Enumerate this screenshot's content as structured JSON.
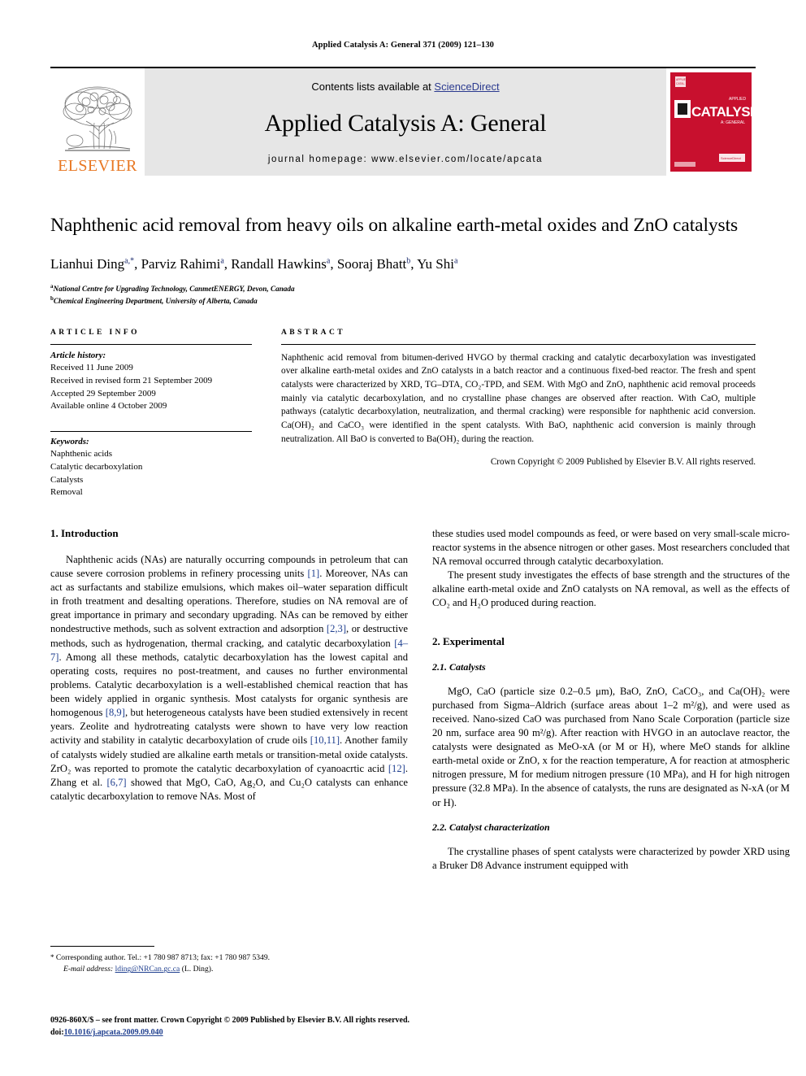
{
  "running_head": "Applied Catalysis A: General 371 (2009) 121–130",
  "masthead": {
    "publisher_name": "ELSEVIER",
    "contents_prefix": "Contents lists available at ",
    "contents_link": "ScienceDirect",
    "journal_title": "Applied Catalysis A: General",
    "homepage_line": "journal homepage: www.elsevier.com/locate/apcata",
    "cover_title": "CATALYSIS",
    "cover_supertitle": "APPLIED",
    "cover_subtitle": "A: GENERAL",
    "cover_color": "#C8102E",
    "link_color": "#2b3a8f",
    "elsevier_orange": "#E87722"
  },
  "title": "Naphthenic acid removal from heavy oils on alkaline earth-metal oxides and ZnO catalysts",
  "authors": {
    "list": [
      {
        "name": "Lianhui Ding",
        "marks": "a,*"
      },
      {
        "name": "Parviz Rahimi",
        "marks": "a"
      },
      {
        "name": "Randall Hawkins",
        "marks": "a"
      },
      {
        "name": "Sooraj Bhatt",
        "marks": "b"
      },
      {
        "name": "Yu Shi",
        "marks": "a"
      }
    ]
  },
  "affiliations": [
    {
      "mark": "a",
      "text": "National Centre for Upgrading Technology, CanmetENERGY, Devon, Canada"
    },
    {
      "mark": "b",
      "text": "Chemical Engineering Department, University of Alberta, Canada"
    }
  ],
  "article_info": {
    "heading": "ARTICLE INFO",
    "history_label": "Article history:",
    "history": [
      "Received 11 June 2009",
      "Received in revised form 21 September 2009",
      "Accepted 29 September 2009",
      "Available online 4 October 2009"
    ],
    "keywords_label": "Keywords:",
    "keywords": [
      "Naphthenic acids",
      "Catalytic decarboxylation",
      "Catalysts",
      "Removal"
    ]
  },
  "abstract": {
    "heading": "ABSTRACT",
    "text": "Naphthenic acid removal from bitumen-derived HVGO by thermal cracking and catalytic decarboxylation was investigated over alkaline earth-metal oxides and ZnO catalysts in a batch reactor and a continuous fixed-bed reactor. The fresh and spent catalysts were characterized by XRD, TG–DTA, CO₂-TPD, and SEM. With MgO and ZnO, naphthenic acid removal proceeds mainly via catalytic decarboxylation, and no crystalline phase changes are observed after reaction. With CaO, multiple pathways (catalytic decarboxylation, neutralization, and thermal cracking) were responsible for naphthenic acid conversion. Ca(OH)₂ and CaCO₃ were identified in the spent catalysts. With BaO, naphthenic acid conversion is mainly through neutralization. All BaO is converted to Ba(OH)₂ during the reaction.",
    "copyright": "Crown Copyright © 2009 Published by Elsevier B.V. All rights reserved."
  },
  "sections": {
    "introduction_heading": "1. Introduction",
    "intro_p1": "Naphthenic acids (NAs) are naturally occurring compounds in petroleum that can cause severe corrosion problems in refinery processing units [1]. Moreover, NAs can act as surfactants and stabilize emulsions, which makes oil–water separation difficult in froth treatment and desalting operations. Therefore, studies on NA removal are of great importance in primary and secondary upgrading. NAs can be removed by either nondestructive methods, such as solvent extraction and adsorption [2,3], or destructive methods, such as hydrogenation, thermal cracking, and catalytic decarboxylation [4–7]. Among all these methods, catalytic decarboxylation has the lowest capital and operating costs, requires no post-treatment, and causes no further environmental problems. Catalytic decarboxylation is a well-established chemical reaction that has been widely applied in organic synthesis. Most catalysts for organic synthesis are homogenous [8,9], but heterogeneous catalysts have been studied extensively in recent years. Zeolite and hydrotreating catalysts were shown to have very low reaction activity and stability in catalytic decarboxylation of crude oils [10,11]. Another family of catalysts widely studied are alkaline earth metals or transition-metal oxide catalysts. ZrO₂ was reported to promote the catalytic decarboxylation of cyanoacrtic acid [12]. Zhang et al. [6,7] showed that MgO, CaO, Ag₂O, and Cu₂O catalysts can enhance catalytic decarboxylation to remove NAs. Most of",
    "intro_p1_cont": "these studies used model compounds as feed, or were based on very small-scale micro-reactor systems in the absence nitrogen or other gases. Most researchers concluded that NA removal occurred through catalytic decarboxylation.",
    "intro_p2": "The present study investigates the effects of base strength and the structures of the alkaline earth-metal oxide and ZnO catalysts on NA removal, as well as the effects of CO₂ and H₂O produced during reaction.",
    "experimental_heading": "2. Experimental",
    "catalysts_heading": "2.1. Catalysts",
    "catalysts_p1": "MgO, CaO (particle size 0.2–0.5 μm), BaO, ZnO, CaCO₃, and Ca(OH)₂ were purchased from Sigma–Aldrich (surface areas about 1–2 m²/g), and were used as received. Nano-sized CaO was purchased from Nano Scale Corporation (particle size 20 nm, surface area 90 m²/g). After reaction with HVGO in an autoclave reactor, the catalysts were designated as MeO-xA (or M or H), where MeO stands for alkline earth-metal oxide or ZnO, x for the reaction temperature, A for reaction at atmospheric nitrogen pressure, M for medium nitrogen pressure (10 MPa), and H for high nitrogen pressure (32.8 MPa). In the absence of catalysts, the runs are designated as N-xA (or M or H).",
    "characterization_heading": "2.2. Catalyst characterization",
    "characterization_p1": "The crystalline phases of spent catalysts were characterized by powder XRD using a Bruker D8 Advance instrument equipped with"
  },
  "footnotes": {
    "corresponding": "Corresponding author. Tel.: +1 780 987 8713; fax: +1 780 987 5349.",
    "email_label": "E-mail address:",
    "email": "lding@NRCan.gc.ca",
    "email_suffix": "(L. Ding).",
    "star": "*"
  },
  "page_footer": {
    "issn_line": "0926-860X/$ – see front matter. Crown Copyright © 2009 Published by Elsevier B.V. All rights reserved.",
    "doi_label": "doi:",
    "doi": "10.1016/j.apcata.2009.09.040"
  }
}
